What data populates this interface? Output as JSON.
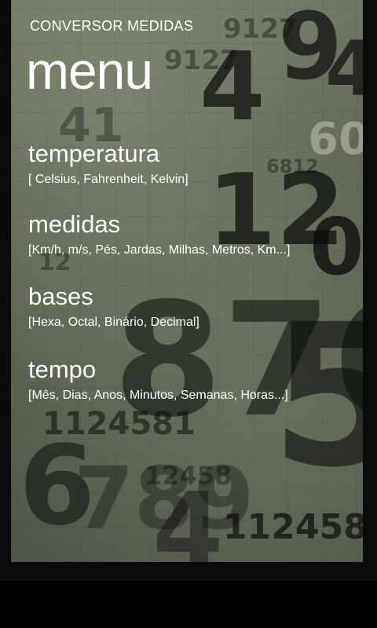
{
  "app": {
    "title": "CONVERSOR MEDIDAS"
  },
  "page": {
    "title": "menu"
  },
  "menu": {
    "items": [
      {
        "label": "temperatura",
        "subtitle": "[ Celsius, Fahrenheit, Kelvin]"
      },
      {
        "label": "medidas",
        "subtitle": "[Km/h, m/s, Pés, Jardas, Milhas, Metros, Km...]"
      },
      {
        "label": "bases",
        "subtitle": "[Hexa, Octal, Binário, Decimal]"
      },
      {
        "label": "tempo",
        "subtitle": "[Mês, Dias, Anos, Minutos, Semanas, Horas...]"
      }
    ]
  }
}
